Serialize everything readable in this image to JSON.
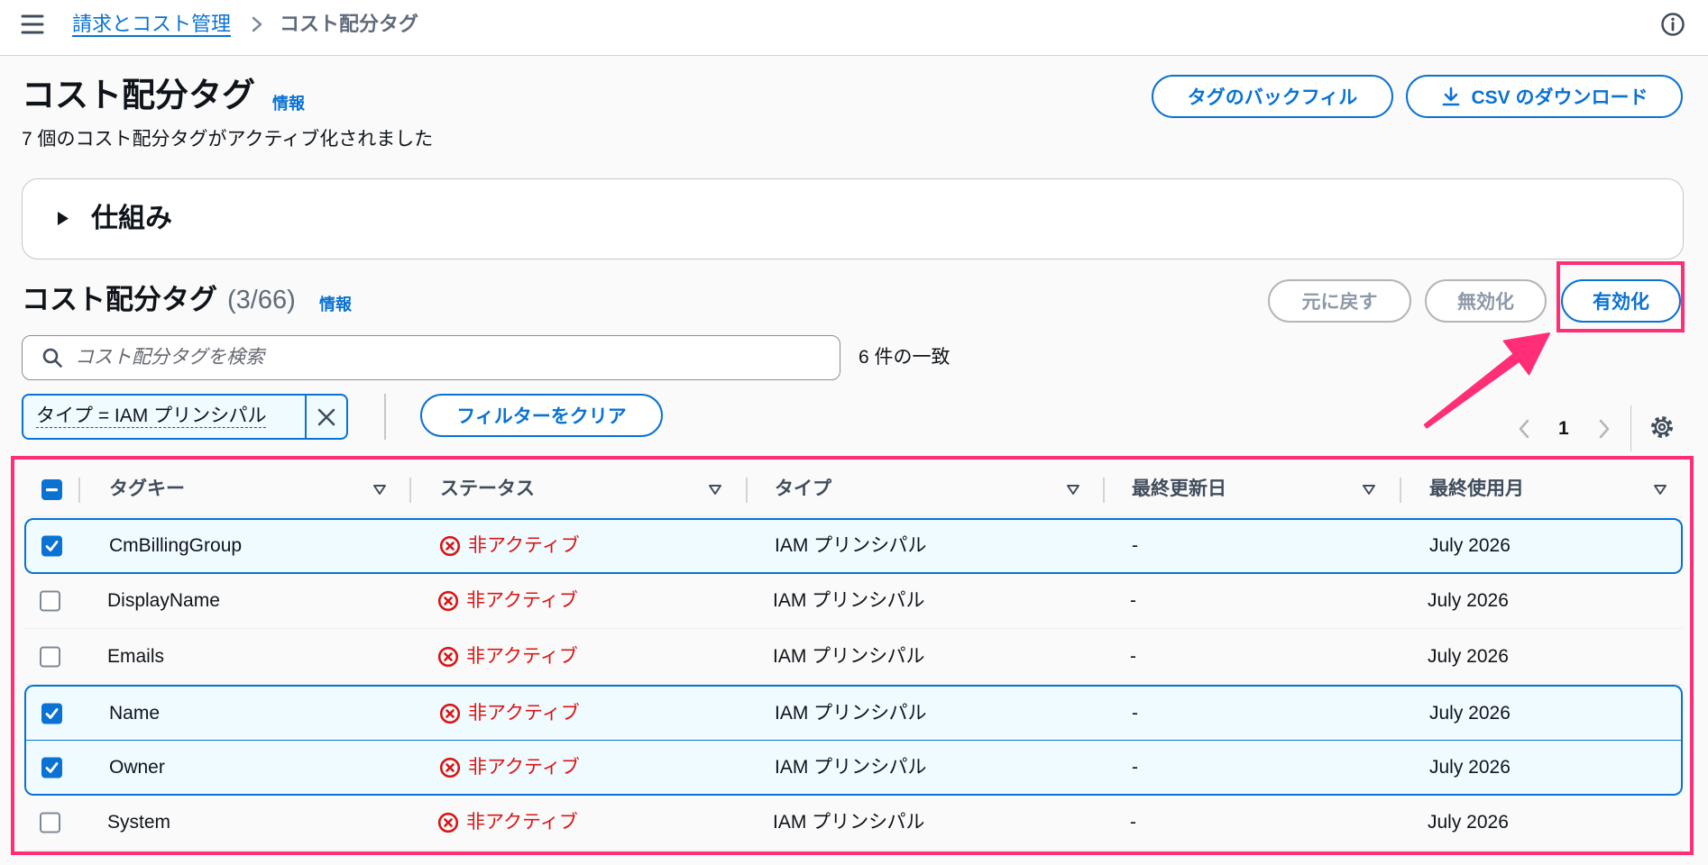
{
  "topbar": {
    "breadcrumb": [
      {
        "label": "請求とコスト管理",
        "link": true
      },
      {
        "label": "コスト配分タグ",
        "link": false
      }
    ]
  },
  "header": {
    "title": "コスト配分タグ",
    "info_link": "情報",
    "subtitle": "7 個のコスト配分タグがアクティブ化されました",
    "actions": {
      "backfill": {
        "label": "タグのバックフィル",
        "enabled": true
      },
      "download_csv": {
        "label": "CSV のダウンロード",
        "enabled": true,
        "icon": "download-icon"
      }
    }
  },
  "how_it_works": {
    "label": "仕組み",
    "expanded": false
  },
  "tags_panel": {
    "title": "コスト配分タグ",
    "counter": "(3/66)",
    "info_link": "情報",
    "actions": {
      "revert": {
        "label": "元に戻す",
        "enabled": false
      },
      "deactivate": {
        "label": "無効化",
        "enabled": false
      },
      "activate": {
        "label": "有効化",
        "enabled": true
      }
    }
  },
  "search": {
    "value": "",
    "placeholder": "コスト配分タグを検索",
    "match_count": "6 件の一致"
  },
  "filters": {
    "tokens": [
      {
        "label": "タイプ = IAM プリンシパル"
      }
    ],
    "clear_label": "フィルターをクリア"
  },
  "pagination": {
    "current_page": "1",
    "prev_enabled": false,
    "next_enabled": false
  },
  "table": {
    "select_all_state": "indeterminate",
    "columns": [
      "タグキー",
      "ステータス",
      "タイプ",
      "最終更新日",
      "最終使用月"
    ],
    "rows": [
      {
        "tag_key": "CmBillingGroup",
        "status": "非アクティブ",
        "type": "IAM プリンシパル",
        "last_updated": "-",
        "last_used": "July 2026",
        "selected": true
      },
      {
        "tag_key": "DisplayName",
        "status": "非アクティブ",
        "type": "IAM プリンシパル",
        "last_updated": "-",
        "last_used": "July 2026",
        "selected": false
      },
      {
        "tag_key": "Emails",
        "status": "非アクティブ",
        "type": "IAM プリンシパル",
        "last_updated": "-",
        "last_used": "July 2026",
        "selected": false
      },
      {
        "tag_key": "Name",
        "status": "非アクティブ",
        "type": "IAM プリンシパル",
        "last_updated": "-",
        "last_used": "July 2026",
        "selected": true
      },
      {
        "tag_key": "Owner",
        "status": "非アクティブ",
        "type": "IAM プリンシパル",
        "last_updated": "-",
        "last_used": "July 2026",
        "selected": true
      },
      {
        "tag_key": "System",
        "status": "非アクティブ",
        "type": "IAM プリンシパル",
        "last_updated": "-",
        "last_used": "July 2026",
        "selected": false
      }
    ]
  },
  "colors": {
    "primary": "#0972d3",
    "status_inactive": "#d91515",
    "selected_row_bg": "#f0fbff",
    "disabled": "#8d99a8",
    "annotation_highlight": "#ff2e76"
  }
}
